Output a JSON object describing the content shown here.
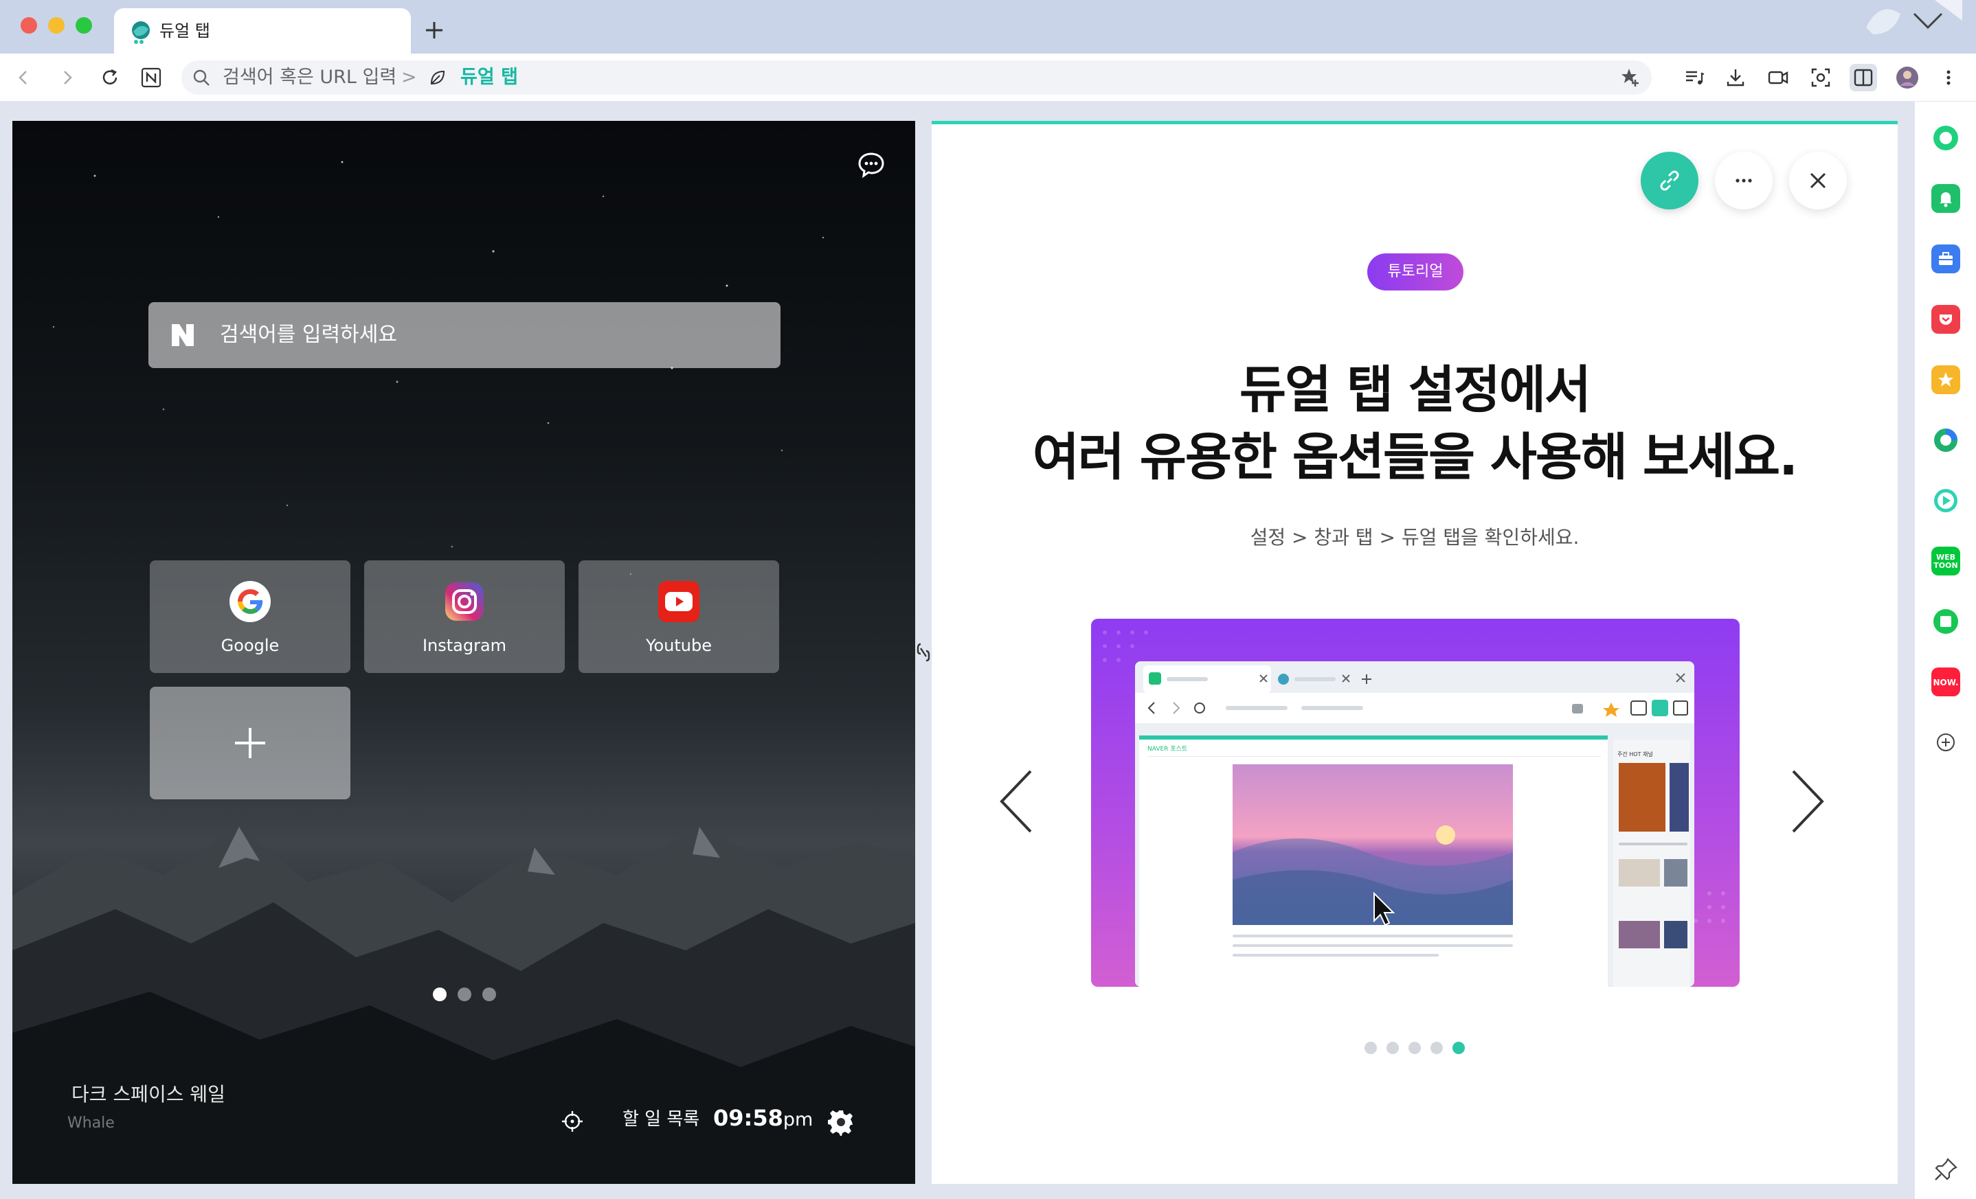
{
  "tab": {
    "title": "듀얼 탭"
  },
  "addressbar": {
    "placeholder": "검색어 혹은 URL 입력",
    "separator": ">",
    "page_name": "듀얼 탭"
  },
  "left_pane": {
    "search_placeholder": "검색어를 입력하세요",
    "shortcuts": [
      {
        "label": "Google",
        "icon": "google-icon"
      },
      {
        "label": "Instagram",
        "icon": "instagram-icon"
      },
      {
        "label": "Youtube",
        "icon": "youtube-icon"
      }
    ],
    "page_count": 3,
    "active_page": 1,
    "theme_name": "다크 스페이스 웨일",
    "theme_author": "Whale",
    "todo_label": "할 일 목록",
    "time": "09:58",
    "ampm": "pm"
  },
  "right_pane": {
    "badge": "튜토리얼",
    "headline_line1": "듀얼 탭 설정에서",
    "headline_line2": "여러 유용한 옵션들을 사용해 보세요.",
    "subline": "설정 > 창과 탭 > 듀얼 탭을 확인하세요.",
    "slide_count": 5,
    "active_slide": 5,
    "preview": {
      "logo_text": "NAVER 포스트",
      "side_title": "주간 HOT 채널"
    }
  },
  "sidebar": {
    "items": [
      "green-circle-icon",
      "bell-icon",
      "briefcase-icon",
      "pocket-icon",
      "star-icon",
      "papago-icon",
      "play-icon",
      "webtoon-icon",
      "square-icon",
      "now-icon",
      "plus-icon"
    ],
    "webtoon_label": "WEB TOON",
    "now_label": "NOW."
  },
  "colors": {
    "accent": "#2dc6a7",
    "badge_start": "#8a3cf0",
    "badge_end": "#c04bd9",
    "youtube": "#e62117"
  }
}
